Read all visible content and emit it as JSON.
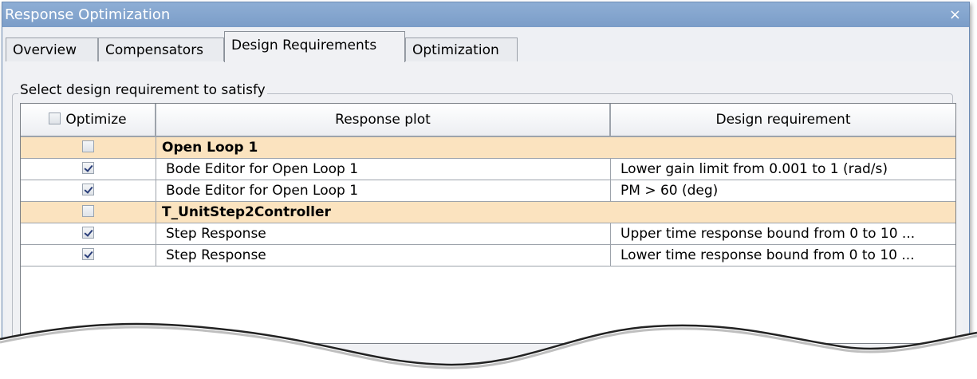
{
  "window": {
    "title": "Response Optimization",
    "close_glyph": "×"
  },
  "tabs": [
    {
      "label": "Overview",
      "active": false
    },
    {
      "label": "Compensators",
      "active": false
    },
    {
      "label": "Design Requirements",
      "active": true
    },
    {
      "label": "Optimization",
      "active": false
    }
  ],
  "group": {
    "legend": "Select design requirement to satisfy"
  },
  "table": {
    "headers": {
      "optimize": "Optimize",
      "response_plot": "Response plot",
      "design_requirement": "Design requirement"
    },
    "header_checkbox_checked": false,
    "rows": [
      {
        "type": "group",
        "checked": false,
        "plot": "Open Loop 1",
        "requirement": ""
      },
      {
        "type": "item",
        "checked": true,
        "plot": "Bode Editor for Open Loop 1",
        "requirement": "Lower gain limit from 0.001 to 1 (rad/s)"
      },
      {
        "type": "item",
        "checked": true,
        "plot": "Bode Editor for Open Loop 1",
        "requirement": "PM > 60 (deg)"
      },
      {
        "type": "group",
        "checked": false,
        "plot": "T_UnitStep2Controller",
        "requirement": ""
      },
      {
        "type": "item",
        "checked": true,
        "plot": "Step Response",
        "requirement": "Upper time response bound from 0 to 10 ..."
      },
      {
        "type": "item",
        "checked": true,
        "plot": "Step Response",
        "requirement": "Lower time response bound from 0 to 10 ..."
      }
    ]
  },
  "colors": {
    "titlebar": "#7b9dc8",
    "group_row": "#fbe3bf"
  }
}
